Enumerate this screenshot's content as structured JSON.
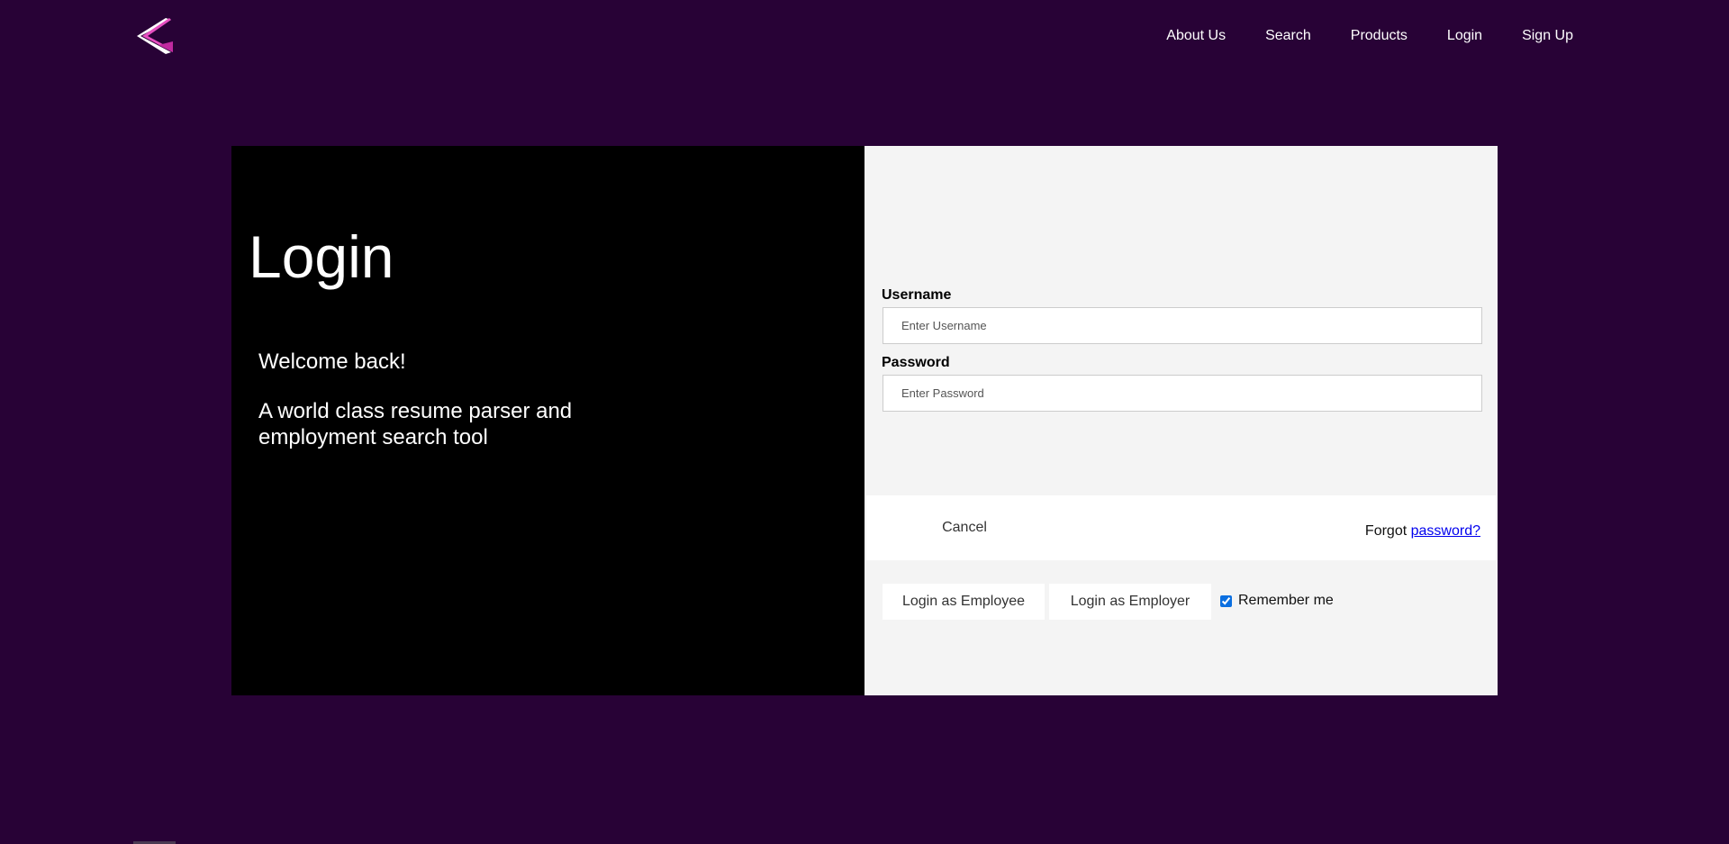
{
  "nav": {
    "logo_icon": "chevron-left-logo",
    "links": [
      "About Us",
      "Search",
      "Products",
      "Login",
      "Sign Up"
    ]
  },
  "left_panel": {
    "title": "Login",
    "welcome": "Welcome back!",
    "tagline": "A world class resume parser and employment search tool"
  },
  "form": {
    "username_label": "Username",
    "username_placeholder": "Enter Username",
    "password_label": "Password",
    "password_placeholder": "Enter Password",
    "employee_button": "Login as Employee",
    "employer_button": "Login as Employer",
    "remember_label": "Remember me",
    "remember_checked": true,
    "cancel_button": "Cancel",
    "forgot_prefix": "Forgot",
    "forgot_link": "password?"
  },
  "colors": {
    "page_bg": "#280236",
    "left_panel_bg": "#000000",
    "right_panel_bg": "#f4f4f4",
    "logo_pink": "#e64fc0",
    "link_blue": "#0000ee"
  }
}
